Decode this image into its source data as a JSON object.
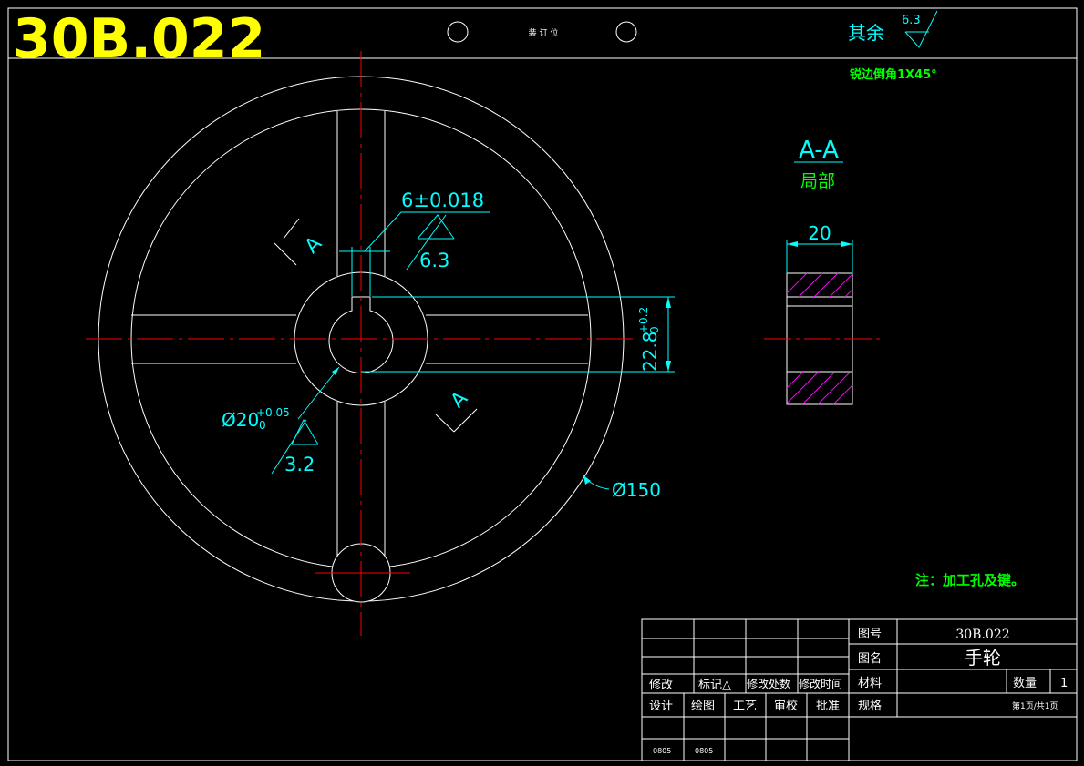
{
  "drawing_number_big": "30B.022",
  "binding_label": "装 订 位",
  "surface": {
    "rest_label": "其余",
    "rest_value": "6.3",
    "chamfer_note": "锐边倒角1X45°"
  },
  "section": {
    "title": "A-A",
    "subtitle": "局部",
    "width_dim": "20"
  },
  "dimensions": {
    "keyway_width": "6±0.018",
    "keyway_roughness": "6.3",
    "key_depth_main": "22.8",
    "key_depth_tol_upper": "+0.2",
    "key_depth_tol_lower": "0",
    "bore_main": "Ø20",
    "bore_tol_upper": "+0.05",
    "bore_tol_lower": "0",
    "bore_roughness": "3.2",
    "outer_diameter": "Ø150"
  },
  "section_marks": [
    "A",
    "A"
  ],
  "note": "注：加工孔及键。",
  "title_block": {
    "drawing_no_label": "图号",
    "drawing_no": "30B.022",
    "name_label": "图名",
    "name": "手轮",
    "material_label": "材料",
    "material": "",
    "qty_label": "数量",
    "qty": "1",
    "spec_label": "规格",
    "sheet": "第1页/共1页",
    "rev_headers": [
      "修改",
      "标记△",
      "修改处数",
      "修改时间"
    ],
    "sign_headers": [
      "设计",
      "绘图",
      "工艺",
      "审校",
      "批准"
    ],
    "sign_values": [
      "0805",
      "0805"
    ]
  },
  "colors": {
    "background": "#000000",
    "outline": "#ffffff",
    "centerline": "#ff0000",
    "dimension": "#00ffff",
    "note": "#00ff00",
    "title": "#ffff00",
    "hatch": "#ff00ff"
  }
}
